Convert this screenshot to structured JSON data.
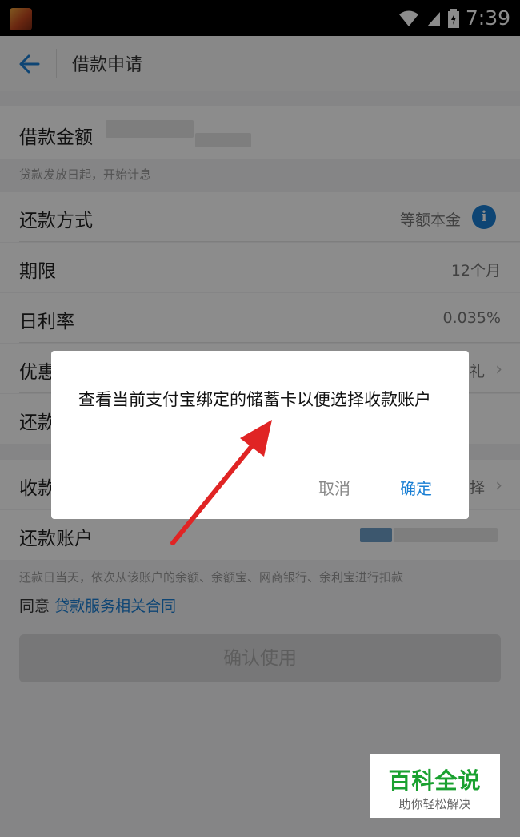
{
  "status": {
    "time": "7:39"
  },
  "nav": {
    "title": "借款申请"
  },
  "form": {
    "amount_label": "借款金额",
    "amount_hint": "贷款发放日起，开始计息",
    "rows": [
      {
        "label": "还款方式",
        "value": "等额本金"
      },
      {
        "label": "期限",
        "value": "12个月"
      },
      {
        "label": "日利率",
        "value": "0.035%"
      },
      {
        "label": "优惠",
        "value": "礼"
      },
      {
        "label": "还款",
        "value": ""
      },
      {
        "label": "收款",
        "value": "择"
      },
      {
        "label": "还款账户",
        "value": ""
      }
    ],
    "repay_hint": "还款日当天，依次从该账户的余额、余额宝、网商银行、余利宝进行扣款",
    "agree_prefix": "同意",
    "agree_link": "贷款服务相关合同",
    "confirm_label": "确认使用"
  },
  "dialog": {
    "message": "查看当前支付宝绑定的储蓄卡以便选择收款账户",
    "cancel": "取消",
    "ok": "确定"
  },
  "watermark": {
    "title": "百科全说",
    "subtitle": "助你轻松解决"
  },
  "colors": {
    "accent": "#1a7fd4",
    "arrow": "#e02424",
    "watermark": "#1aa130"
  }
}
